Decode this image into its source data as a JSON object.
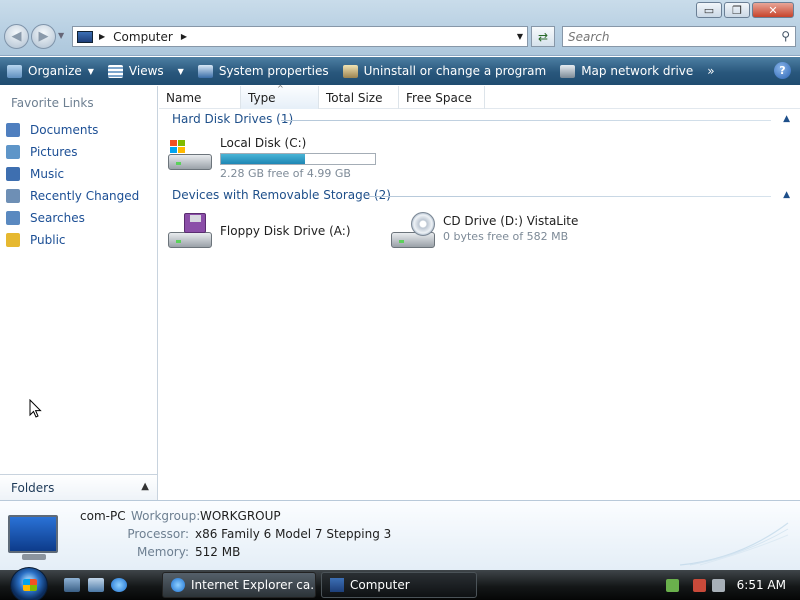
{
  "titlebar": {
    "controls": {
      "minimize": "▭",
      "maximize": "❐",
      "close": "✕"
    }
  },
  "address": {
    "location": "Computer",
    "search_placeholder": "Search"
  },
  "commandbar": {
    "items": [
      {
        "label": "Organize",
        "icon": "organize-icon"
      },
      {
        "label": "Views",
        "icon": "views-icon"
      },
      {
        "label": "System properties",
        "icon": "system-properties-icon"
      },
      {
        "label": "Uninstall or change a program",
        "icon": "uninstall-icon"
      },
      {
        "label": "Map network drive",
        "icon": "map-network-drive-icon"
      }
    ],
    "more": "»",
    "help": "?"
  },
  "sidebar": {
    "title": "Favorite Links",
    "items": [
      {
        "label": "Documents",
        "color": "#4f7fbf"
      },
      {
        "label": "Pictures",
        "color": "#5e95c8"
      },
      {
        "label": "Music",
        "color": "#3e6fb0"
      },
      {
        "label": "Recently Changed",
        "color": "#6e8fb5"
      },
      {
        "label": "Searches",
        "color": "#5a89c0"
      },
      {
        "label": "Public",
        "color": "#e6b830"
      }
    ],
    "folders_label": "Folders"
  },
  "columns": [
    "Name",
    "Type",
    "Total Size",
    "Free Space"
  ],
  "groups": {
    "hdd": {
      "label": "Hard Disk Drives (1)"
    },
    "removable": {
      "label": "Devices with Removable Storage (2)"
    }
  },
  "drives": {
    "c": {
      "name": "Local Disk (C:)",
      "detail": "2.28 GB free of 4.99 GB",
      "used_fraction": 0.543
    },
    "a": {
      "name": "Floppy Disk Drive (A:)"
    },
    "d": {
      "name": "CD Drive (D:) VistaLite",
      "detail": "0 bytes free of 582 MB"
    }
  },
  "details": {
    "pc_name": "com-PC",
    "workgroup_label": "Workgroup:",
    "workgroup": "WORKGROUP",
    "processor_label": "Processor:",
    "processor": "x86 Family 6 Model 7 Stepping 3",
    "memory_label": "Memory:",
    "memory": "512 MB"
  },
  "taskbar": {
    "windows": [
      {
        "label": "Internet Explorer ca...",
        "active": false
      },
      {
        "label": "Computer",
        "active": true
      }
    ],
    "time": "6:51 AM"
  },
  "colors": {
    "accent": "#1e4f8a",
    "link": "#1c4f95",
    "commandbar": "#29577c",
    "drive_bar": "#1e86b4"
  }
}
